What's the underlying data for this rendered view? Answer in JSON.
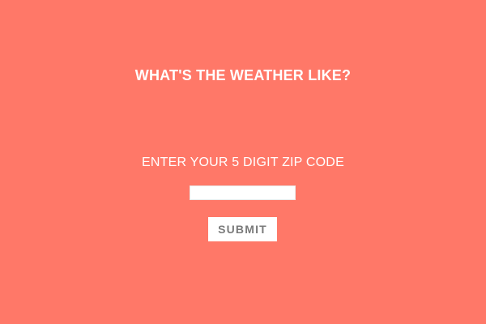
{
  "header": {
    "title": "WHAT'S THE WEATHER LIKE?"
  },
  "form": {
    "prompt": "ENTER YOUR 5 DIGIT ZIP CODE",
    "zip_value": "",
    "zip_placeholder": "",
    "submit_label": "SUBMIT"
  },
  "colors": {
    "background": "#ff7868",
    "text": "#ffffff",
    "button_text": "#7a7a7a"
  }
}
